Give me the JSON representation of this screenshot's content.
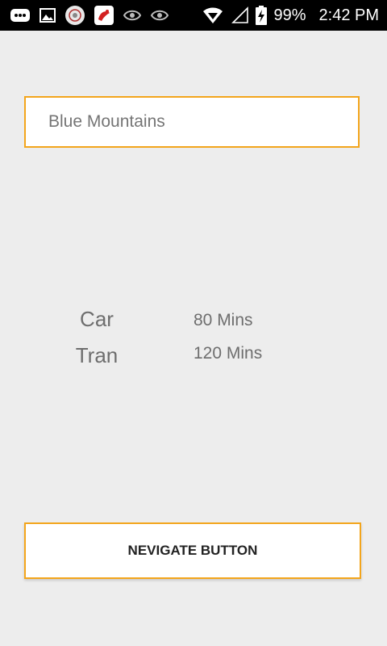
{
  "status_bar": {
    "battery_percent": "99%",
    "time": "2:42 PM",
    "icons": [
      "more-icon",
      "image-icon",
      "app-icon-1",
      "app-icon-2",
      "eye-icon",
      "eye-icon",
      "wifi-icon",
      "signal-icon",
      "battery-charging-icon"
    ]
  },
  "destination": {
    "value": "Blue Mountains",
    "placeholder": ""
  },
  "travel_times": [
    {
      "mode": "Car",
      "duration": "80 Mins"
    },
    {
      "mode": "Tran",
      "duration": "120 Mins"
    }
  ],
  "navigate_button": {
    "label": "NEVIGATE BUTTON"
  },
  "colors": {
    "accent_border": "#f3a51c",
    "background": "#ededed",
    "text": "#6e6e6e"
  }
}
